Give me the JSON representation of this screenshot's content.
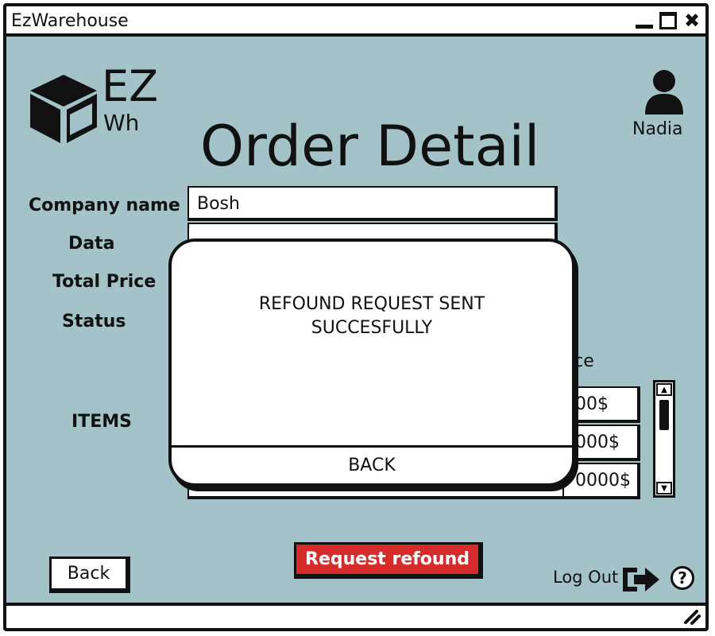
{
  "window": {
    "title": "EzWarehouse",
    "min_icon": "minimize-icon",
    "max_icon": "maximize-icon",
    "close_icon": "close-icon",
    "close_glyph": "✖"
  },
  "logo": {
    "line1": "EZ",
    "line2": "Wh",
    "icon": "box-icon"
  },
  "user": {
    "name": "Nadia",
    "icon": "user-icon"
  },
  "page": {
    "title": "Order Detail"
  },
  "form": {
    "labels": {
      "company": "Company name",
      "date": "Data",
      "total": "Total Price",
      "status": "Status",
      "items": "ITEMS"
    },
    "company_value": "Bosh"
  },
  "items_table": {
    "price_header_partial": "ice",
    "price_values_partial": [
      "00$",
      "000$",
      "0000$"
    ]
  },
  "buttons": {
    "back": "Back",
    "request_refund": "Request refound",
    "logout": "Log Out",
    "help": "?"
  },
  "modal": {
    "message_line1": "REFOUND REQUEST SENT",
    "message_line2": "SUCCESFULLY",
    "back": "BACK"
  },
  "colors": {
    "background": "#a3c3c8",
    "refund_button": "#d62b2b",
    "ink": "#111111"
  }
}
